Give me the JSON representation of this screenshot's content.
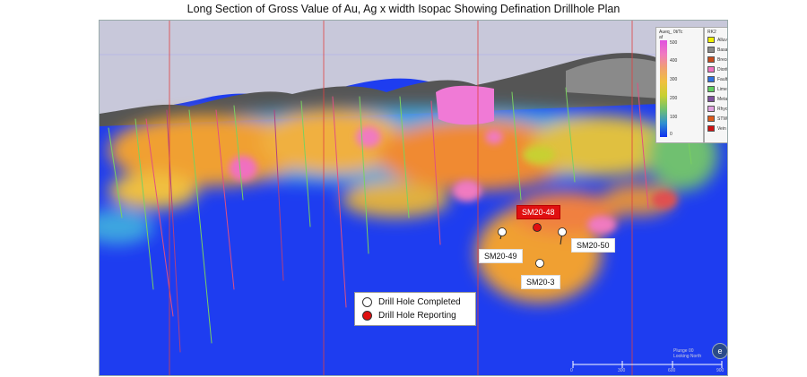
{
  "title": "Long Section of Gross Value of Au, Ag x width Isopac Showing Defination Drillhole Plan",
  "drill_holes": [
    {
      "id": "SM20-48",
      "status": "reporting"
    },
    {
      "id": "SM20-49",
      "status": "completed"
    },
    {
      "id": "SM20-50",
      "status": "completed"
    },
    {
      "id": "SM20-3",
      "status": "completed"
    }
  ],
  "legend": {
    "completed": "Drill Hole Completed",
    "reporting": "Drill Hole Reporting"
  },
  "colorbar": {
    "title": "Aueq_ 0t/Tc af",
    "ticks": [
      "500",
      "400",
      "300",
      "200",
      "100",
      "0"
    ]
  },
  "rock_legend": {
    "title": "RK2",
    "items": [
      {
        "label": "Alluvium",
        "color": "#f0f000"
      },
      {
        "label": "Basalt",
        "color": "#8a8a8a"
      },
      {
        "label": "Breccia",
        "color": "#c84a1a"
      },
      {
        "label": "Diorite",
        "color": "#f070c0"
      },
      {
        "label": "Fault",
        "color": "#3070e0"
      },
      {
        "label": "Limestone",
        "color": "#60d060"
      },
      {
        "label": "Metamorfic",
        "color": "#8050a0"
      },
      {
        "label": "Rhyolite",
        "color": "#e0a0e0"
      },
      {
        "label": "STW",
        "color": "#e05a1a"
      },
      {
        "label": "Vein",
        "color": "#d01010"
      }
    ]
  },
  "north_label": "Plunge 00 Looking North",
  "scale_ticks": [
    "0",
    "300",
    "600",
    "900"
  ],
  "colors": {
    "reporting": "#e01010",
    "completed": "#ffffff",
    "background_blue": "#1e3df0",
    "sky": "#c6c6d8"
  }
}
